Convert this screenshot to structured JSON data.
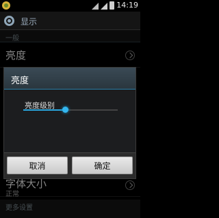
{
  "status_bar": {
    "time": "14:19"
  },
  "header": {
    "title": "显示"
  },
  "sections": {
    "general": "一般",
    "more": "更多设置"
  },
  "items": {
    "brightness": {
      "label": "亮度"
    },
    "font_size": {
      "label": "字体大小",
      "value": "正常"
    }
  },
  "dialog": {
    "title": "亮度",
    "slider_label": "亮度级别",
    "slider_value": 0.44,
    "cancel": "取消",
    "ok": "确定"
  },
  "colors": {
    "accent": "#29a8e0",
    "dialog_title_bg": "#34434c"
  },
  "icons": {
    "app": "app-notification-icon",
    "settings": "settings-icon",
    "chevron": "chevron-right-icon"
  }
}
